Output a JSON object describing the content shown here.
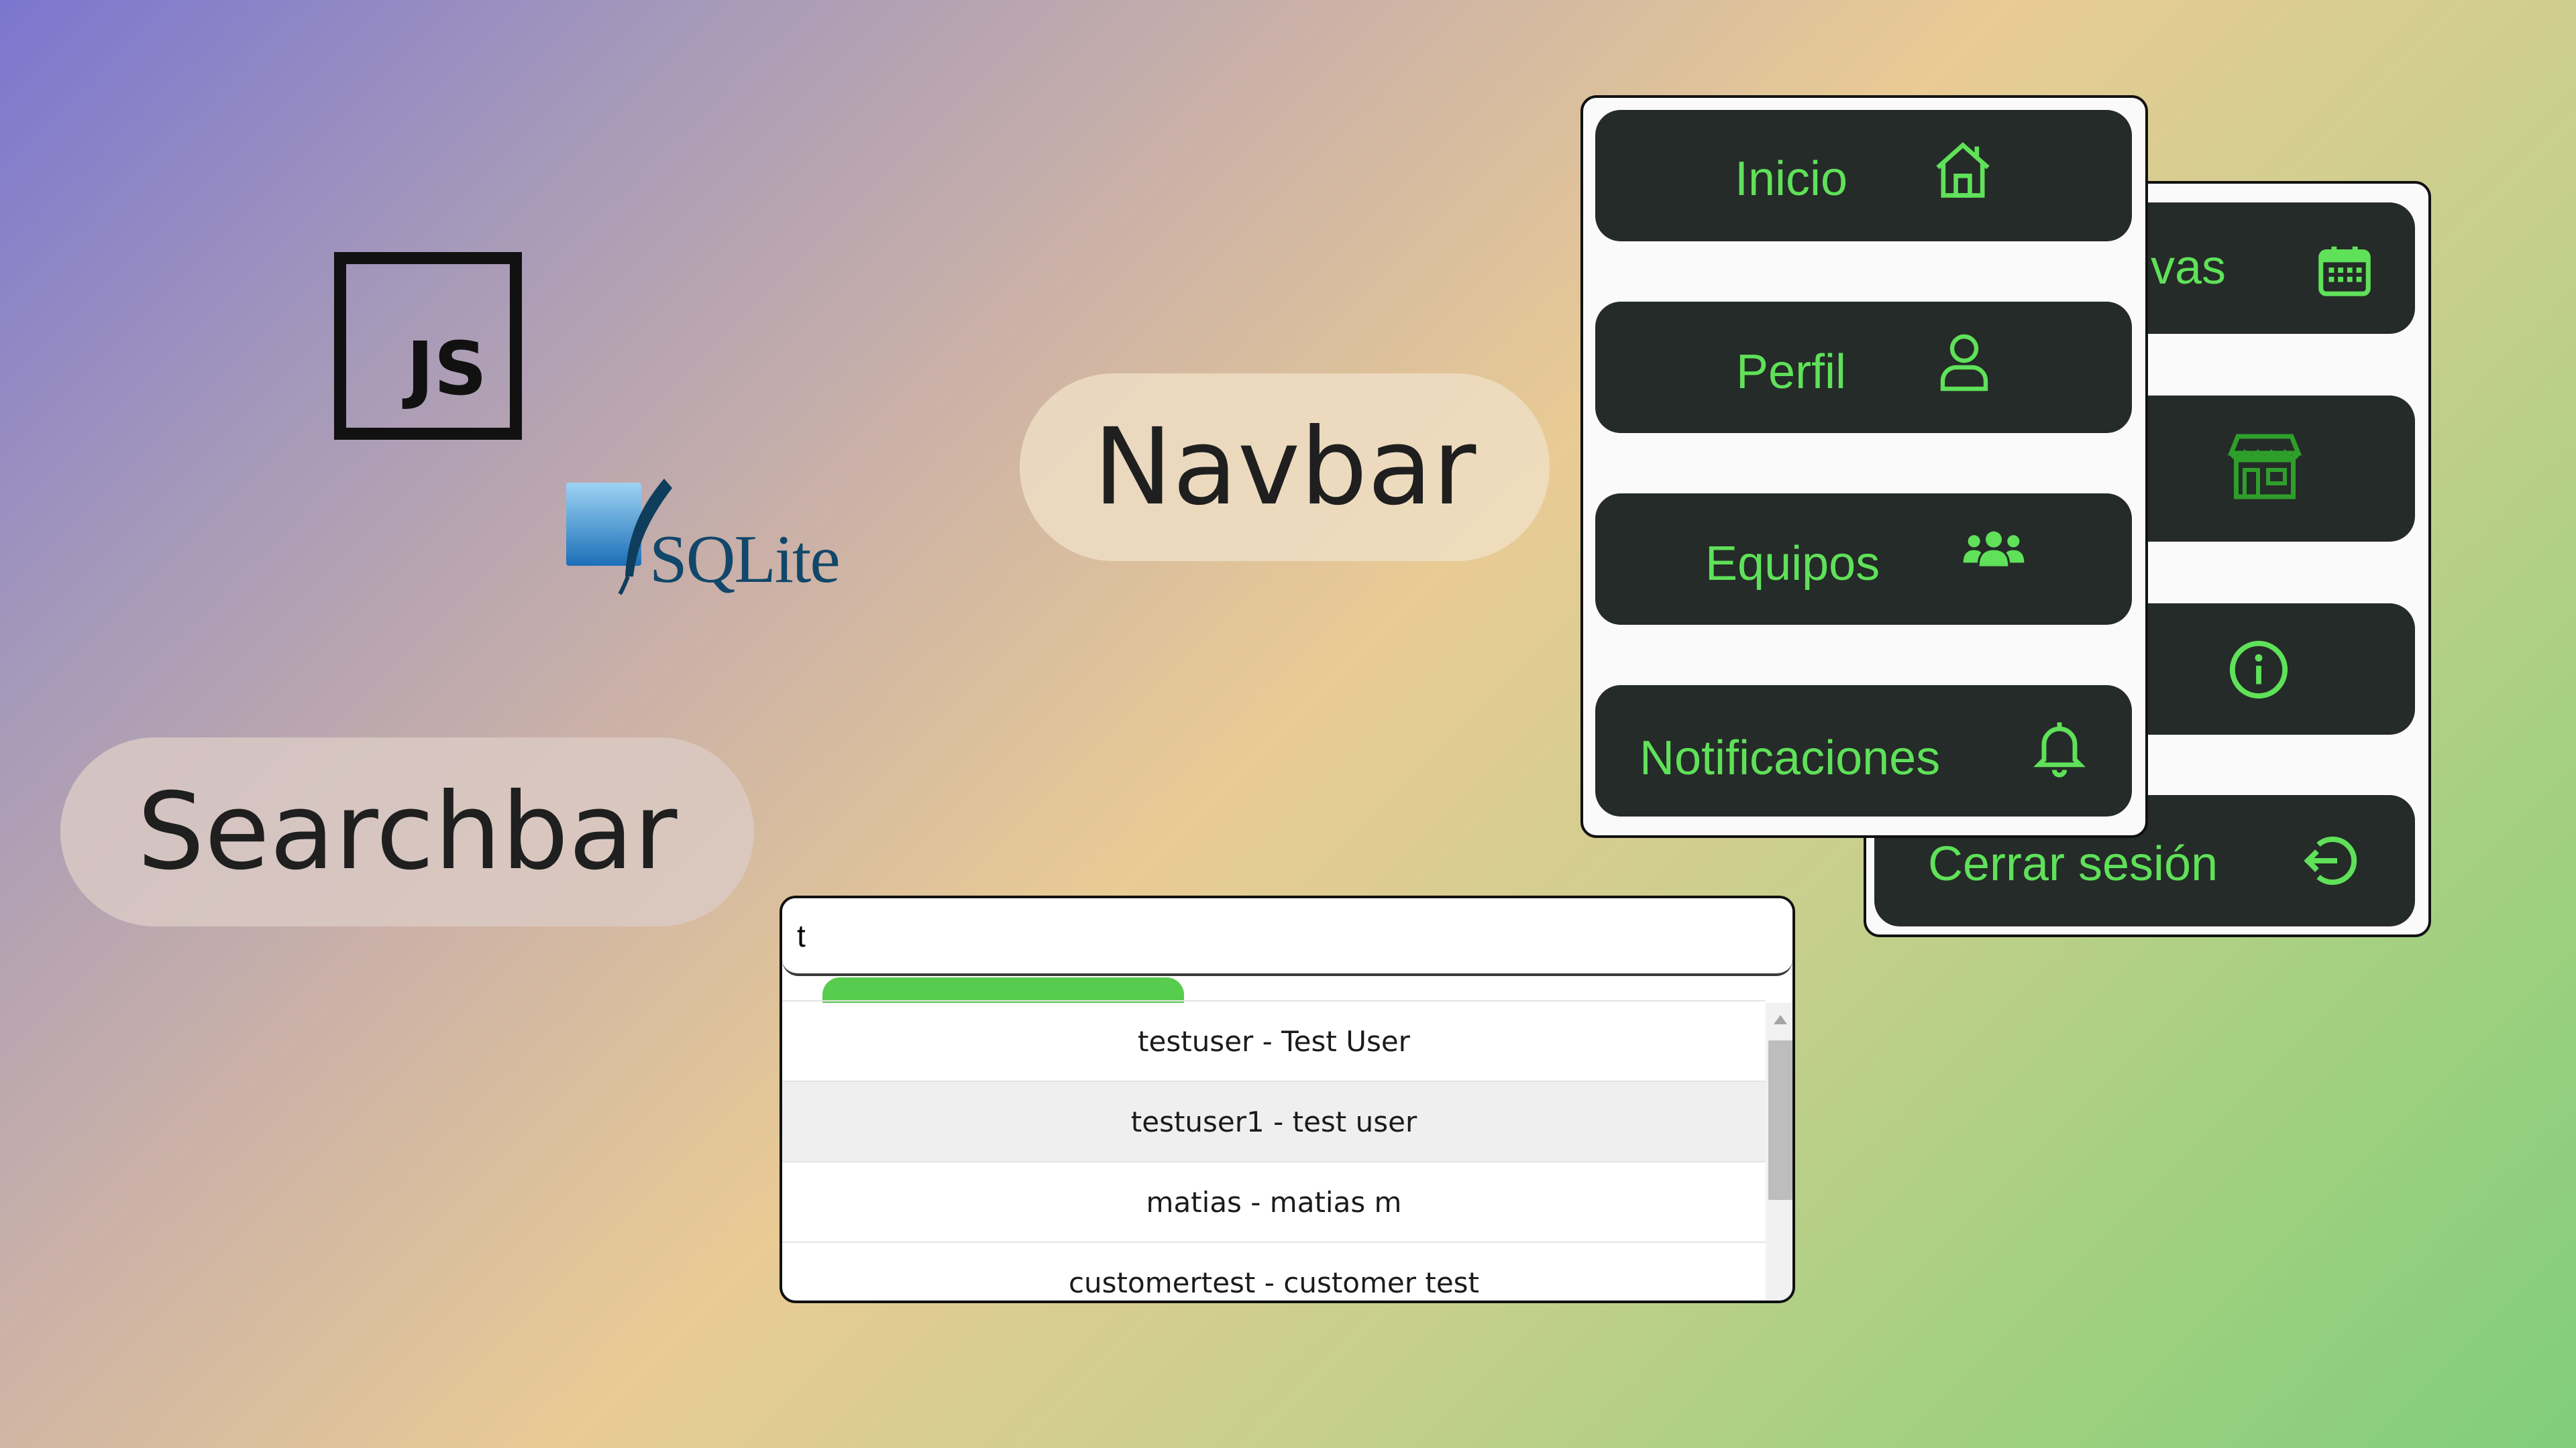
{
  "logos": {
    "js_text": "JS",
    "sqlite_text": "SQLite"
  },
  "labels": {
    "navbar": "Navbar",
    "searchbar": "Searchbar"
  },
  "navbar_back": {
    "items": [
      {
        "label": "vas",
        "icon": "calendar-icon"
      },
      {
        "label": "",
        "icon": "store-icon"
      },
      {
        "label": "",
        "icon": "info-icon"
      },
      {
        "label": "Cerrar sesión",
        "icon": "logout-icon"
      }
    ]
  },
  "navbar_front": {
    "items": [
      {
        "label": "Inicio",
        "icon": "home-icon"
      },
      {
        "label": "Perfil",
        "icon": "user-icon"
      },
      {
        "label": "Equipos",
        "icon": "users-icon"
      },
      {
        "label": "Notificaciones",
        "icon": "bell-icon"
      }
    ]
  },
  "search": {
    "value": "t",
    "loading_progress_fraction": 0.55,
    "results": [
      "testuser - Test User",
      "testuser1 - test user",
      "matias - matias m",
      "customertest - customer test"
    ]
  },
  "colors": {
    "navbar_button_bg": "#252b28",
    "navbar_accent": "#5fe159",
    "progress_green": "#58cc4f"
  }
}
